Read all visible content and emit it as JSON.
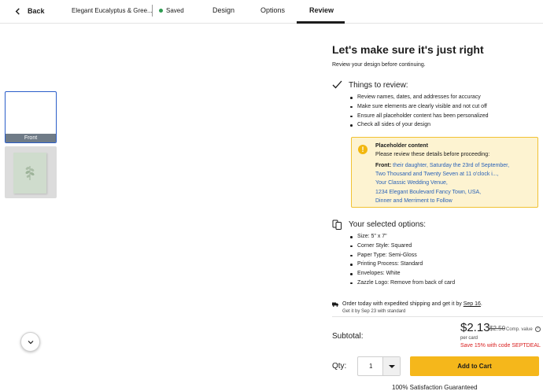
{
  "topbar": {
    "back_label": "Back",
    "doc_name": "Elegant Eucalyptus & Gree...",
    "saved_label": "Saved",
    "tabs": [
      "Design",
      "Options",
      "Review"
    ],
    "active_tab": "Review"
  },
  "thumbnails": {
    "front_label": "Front"
  },
  "review": {
    "title": "Let's make sure it's just right",
    "subtitle": "Review your design before continuing.",
    "things_title": "Things to review:",
    "things": [
      "Review names, dates, and addresses for accuracy",
      "Make sure elements are clearly visible and not cut off",
      "Ensure all placeholder content has been personalized",
      "Check all sides of your design"
    ],
    "notice": {
      "title": "Placeholder content",
      "subtitle": "Please review these details before proceeding:",
      "front_label": "Front:",
      "front_lines": [
        "their daughter, Saturday the 23rd of September,",
        "Two Thousand and Twenty Seven at 11 o'clock i...,",
        "Your Classic Wedding Venue,",
        "1234 Elegant Boulevard Fancy Town, USA,",
        "Dinner and Merriment to Follow"
      ]
    },
    "options_title": "Your selected options:",
    "options": [
      "Size: 5\" x 7\"",
      "Corner Style: Squared",
      "Paper Type: Semi-Gloss",
      "Printing Process: Standard",
      "Envelopes: White",
      "Zazzle Logo: Remove from back of card"
    ]
  },
  "shipping": {
    "line1_prefix": "Order today with expedited shipping and get it by ",
    "line1_date": "Sep 16",
    "line1_suffix": ".",
    "line2": "Get it by Sep 23 with standard"
  },
  "pricing": {
    "subtotal_label": "Subtotal:",
    "price": "$2.13",
    "old_price": "$2.50",
    "comp_label": "Comp. value",
    "per_card": "per card",
    "promo": "Save 15% with code SEPTDEAL"
  },
  "purchase": {
    "qty_label": "Qty:",
    "qty_value": "1",
    "cart_label": "Add to Cart",
    "guarantee": "100% Satisfaction Guaranteed"
  },
  "colors": {
    "accent_yellow": "#f5b71b",
    "link_blue": "#2a62b8",
    "promo_red": "#d92020",
    "saved_green": "#2e9b51",
    "thumb_selected": "#2b5ec9"
  },
  "icons": [
    "chevron-left-icon",
    "check-icon",
    "info-icon",
    "cards-icon",
    "truck-icon",
    "chevron-down-icon",
    "question-icon",
    "eucalyptus-icon"
  ]
}
